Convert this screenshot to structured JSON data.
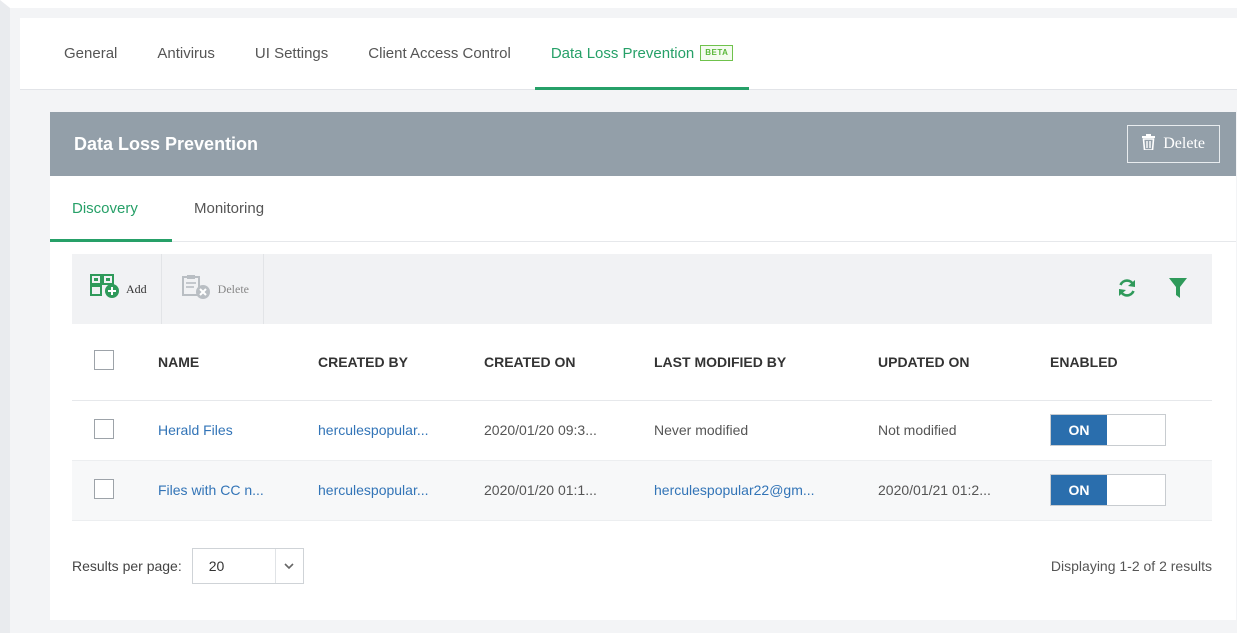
{
  "top_tabs": [
    {
      "label": "General"
    },
    {
      "label": "Antivirus"
    },
    {
      "label": "UI Settings"
    },
    {
      "label": "Client Access Control"
    },
    {
      "label": "Data Loss Prevention",
      "badge": "BETA",
      "active": true
    }
  ],
  "card": {
    "title": "Data Loss Prevention",
    "delete_label": "Delete"
  },
  "sub_tabs": [
    {
      "label": "Discovery",
      "active": true
    },
    {
      "label": "Monitoring"
    }
  ],
  "toolbar": {
    "add_label": "Add",
    "delete_label": "Delete",
    "icons": [
      "add-policy-icon",
      "delete-policy-icon",
      "refresh-icon",
      "filter-icon"
    ]
  },
  "table": {
    "columns": [
      "NAME",
      "CREATED BY",
      "CREATED ON",
      "LAST MODIFIED BY",
      "UPDATED ON",
      "ENABLED"
    ],
    "rows": [
      {
        "name": "Herald Files",
        "created_by": "herculespopular...",
        "created_on": "2020/01/20 09:3...",
        "last_modified_by": "Never modified",
        "updated_on": "Not modified",
        "enabled": "ON"
      },
      {
        "name": "Files with CC n...",
        "created_by": "herculespopular...",
        "created_on": "2020/01/20 01:1...",
        "last_modified_by": "herculespopular22@gm...",
        "updated_on": "2020/01/21 01:2...",
        "enabled": "ON"
      }
    ]
  },
  "footer": {
    "results_per_page_label": "Results per page:",
    "results_per_page_value": "20",
    "displaying": "Displaying 1-2 of 2 results"
  },
  "colors": {
    "accent_green": "#26a068",
    "header_gray": "#939fa9",
    "link_blue": "#3274b7",
    "toggle_blue": "#2a6ead"
  }
}
